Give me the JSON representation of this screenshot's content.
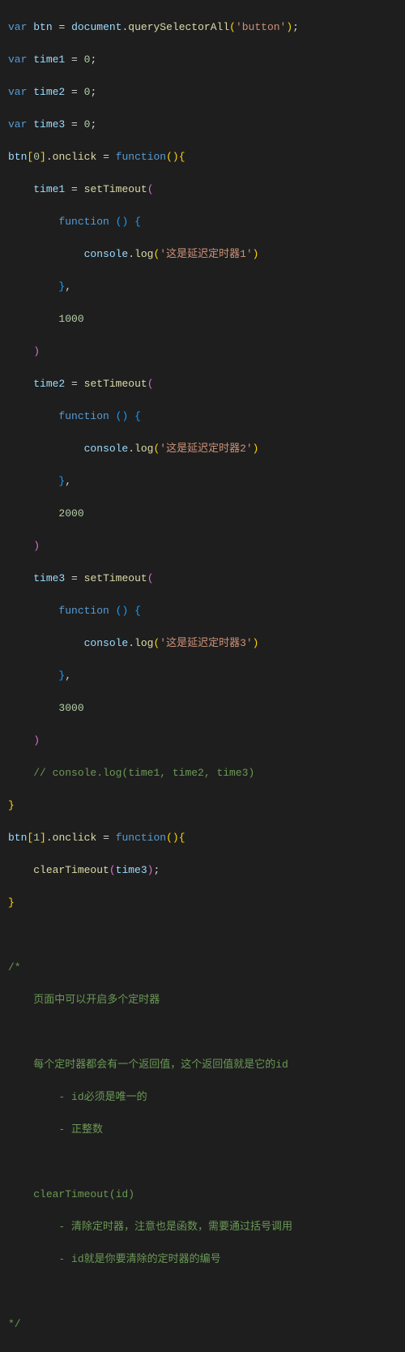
{
  "tokens": {
    "kw_var": "var",
    "kw_function": "function",
    "var_btn": "btn",
    "var_time1": "time1",
    "var_time2": "time2",
    "var_time3": "time3",
    "var_document": "document",
    "var_console": "console",
    "fn_querySelectorAll": "querySelectorAll",
    "fn_setTimeout": "setTimeout",
    "fn_clearTimeout": "clearTimeout",
    "fn_log": "log",
    "prop_onclick": "onclick",
    "num_0": "0",
    "num_1": "1",
    "num_1000": "1000",
    "num_2000": "2000",
    "num_3000": "3000",
    "str_button": "'button'",
    "str_timer1": "'这是延迟定时器1'",
    "str_timer2": "'这是延迟定时器2'",
    "str_timer3": "'这是延迟定时器3'",
    "cmt_consolelog": "// console.log(time1, time2, time3)",
    "cmt_block_open": "/*",
    "cmt_block_l1": "页面中可以开启多个定时器",
    "cmt_block_l2": "每个定时器都会有一个返回值，这个返回值就是它的id",
    "cmt_block_l2a": "- id必须是唯一的",
    "cmt_block_l2b": "- 正整数",
    "cmt_block_l3": "clearTimeout(id)",
    "cmt_block_l3a": "- 清除定时器，注意也是函数，需要通过括号调用",
    "cmt_block_l3b": "- id就是你要清除的定时器的编号",
    "cmt_block_close": "*/"
  }
}
